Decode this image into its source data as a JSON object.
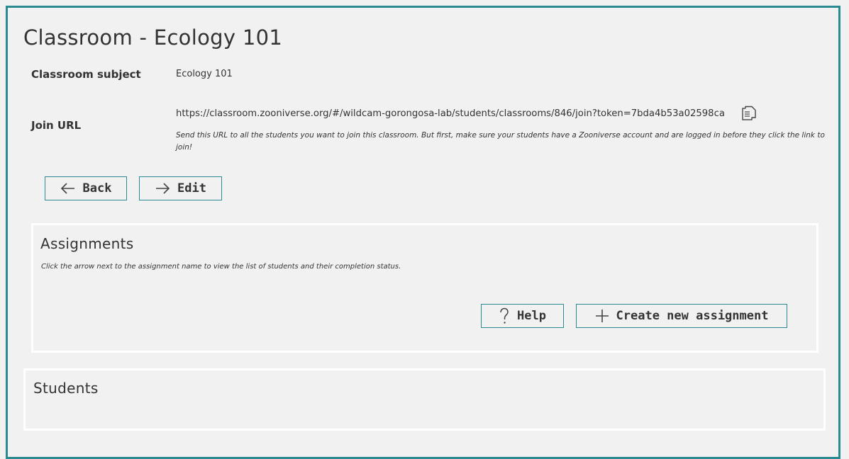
{
  "page": {
    "title": "Classroom - Ecology 101"
  },
  "details": {
    "subject_label": "Classroom subject",
    "subject_value": "Ecology 101",
    "join_url_label": "Join URL",
    "join_url_value": "https://classroom.zooniverse.org/#/wildcam-gorongosa-lab/students/classrooms/846/join?token=7bda4b53a02598ca",
    "join_url_note": "Send this URL to all the students you want to join this classroom. But first, make sure your students have a Zooniverse account and are logged in before they click the link to join!",
    "copy_icon": "copy-icon"
  },
  "actions": {
    "back_label": "Back",
    "back_icon": "arrow-left-icon",
    "edit_label": "Edit",
    "edit_icon": "arrow-right-icon"
  },
  "assignments": {
    "title": "Assignments",
    "note": "Click the arrow next to the assignment name to view the list of students and their completion status.",
    "help_label": "Help",
    "help_icon": "question-icon",
    "create_label": "Create new assignment",
    "create_icon": "plus-icon"
  },
  "students": {
    "title": "Students"
  },
  "colors": {
    "accent": "#2a8a91",
    "background": "#f1f1f1",
    "panel_border": "#ffffff",
    "text": "#333333"
  }
}
